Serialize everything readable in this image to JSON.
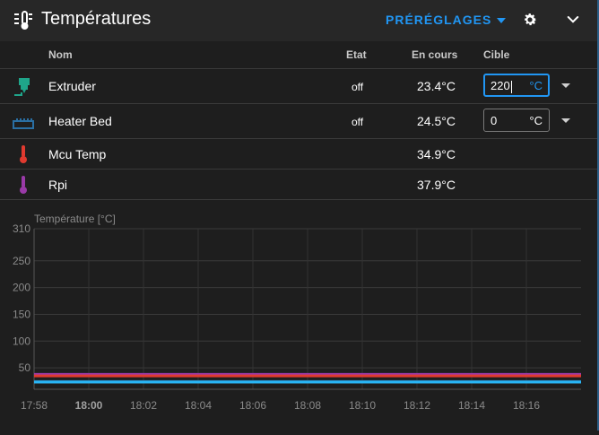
{
  "header": {
    "title": "Températures",
    "presets_label": "PRÉRÉGLAGES",
    "icons": {
      "title": "thermometer-lines-icon",
      "presets_caret": "caret-down-icon",
      "settings": "gear-icon",
      "collapse": "chevron-down-icon"
    }
  },
  "table": {
    "columns": {
      "name": "Nom",
      "state": "Etat",
      "current": "En cours",
      "target": "Cible"
    },
    "rows": [
      {
        "name": "Extruder",
        "state": "off",
        "current": "23.4°C",
        "target_value": "220",
        "target_unit": "°C",
        "icon": "extruder-icon",
        "color": "#1fa58a",
        "active": true
      },
      {
        "name": "Heater Bed",
        "state": "off",
        "current": "24.5°C",
        "target_value": "0",
        "target_unit": "°C",
        "icon": "heater-bed-icon",
        "color": "#2a6fa3",
        "active": false
      },
      {
        "name": "Mcu Temp",
        "state": "",
        "current": "34.9°C",
        "icon": "thermometer-icon",
        "color": "#e03a2f"
      },
      {
        "name": "Rpi",
        "state": "",
        "current": "37.9°C",
        "icon": "thermometer-icon",
        "color": "#9a3aa8"
      }
    ]
  },
  "chart_data": {
    "type": "line",
    "title": "",
    "ylabel": "Température [°C]",
    "xlabel": "",
    "ylim": [
      10,
      310
    ],
    "yticks": [
      50,
      100,
      150,
      200,
      250,
      310
    ],
    "xlim": [
      "17:58",
      "18:18"
    ],
    "xticks": [
      "17:58",
      "18:00",
      "18:02",
      "18:04",
      "18:06",
      "18:08",
      "18:10",
      "18:12",
      "18:14",
      "18:16"
    ],
    "xticks_bold": [
      "18:00"
    ],
    "grid": true,
    "series": [
      {
        "color": "#9a3aa8",
        "x": [
          "17:58",
          "18:18"
        ],
        "y": [
          37.9,
          37.9
        ]
      },
      {
        "color": "#e03a2f",
        "x": [
          "17:58",
          "18:18"
        ],
        "y": [
          34.9,
          34.9
        ]
      },
      {
        "color": "#2a6fa3",
        "x": [
          "17:58",
          "18:18"
        ],
        "y": [
          24.5,
          24.5
        ]
      },
      {
        "color": "#29b6f6",
        "x": [
          "17:58",
          "18:18"
        ],
        "y": [
          23.4,
          23.4
        ]
      }
    ]
  }
}
